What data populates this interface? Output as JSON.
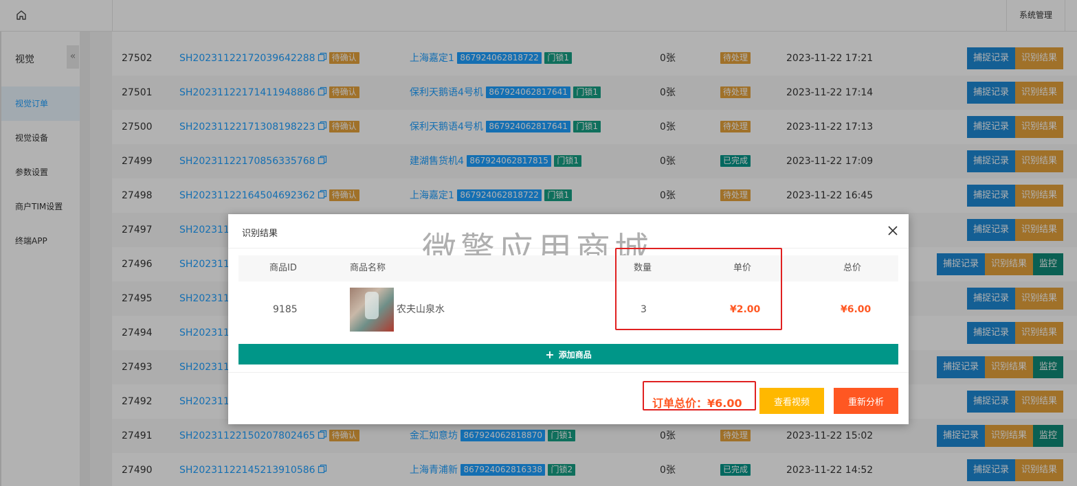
{
  "topbar": {
    "system_menu": "系统管理"
  },
  "sidebar": {
    "title": "视觉",
    "collapse_symbol": "«",
    "items": [
      "视觉订单",
      "视觉设备",
      "参数设置",
      "商户TIM设置",
      "终端APP"
    ]
  },
  "table": {
    "rows": [
      {
        "id": "27502",
        "sn": "SH20231122172039642288",
        "confirm": "待确认",
        "store": "上海嘉定1",
        "device": "867924062818722",
        "lock": "门锁1",
        "qty": "0张",
        "status": "待处理",
        "time": "2023-11-22 17:21"
      },
      {
        "id": "27501",
        "sn": "SH20231122171411948886",
        "confirm": "待确认",
        "store": "保利天鹅语4号机",
        "device": "867924062817641",
        "lock": "门锁1",
        "qty": "0张",
        "status": "待处理",
        "time": "2023-11-22 17:14"
      },
      {
        "id": "27500",
        "sn": "SH20231122171308198223",
        "confirm": "待确认",
        "store": "保利天鹅语4号机",
        "device": "867924062817641",
        "lock": "门锁1",
        "qty": "0张",
        "status": "待处理",
        "time": "2023-11-22 17:13"
      },
      {
        "id": "27499",
        "sn": "SH20231122170856335768",
        "confirm": "",
        "store": "建湖售货机4",
        "device": "867924062817815",
        "lock": "门锁1",
        "qty": "0张",
        "status": "已完成",
        "time": "2023-11-22 17:09"
      },
      {
        "id": "27498",
        "sn": "SH20231122164504692362",
        "confirm": "待确认",
        "store": "上海嘉定1",
        "device": "867924062818722",
        "lock": "门锁1",
        "qty": "0张",
        "status": "待处理",
        "time": "2023-11-22 16:45"
      },
      {
        "id": "27497",
        "sn": "SH2023112"
      },
      {
        "id": "27496",
        "sn": "SH2023112"
      },
      {
        "id": "27495",
        "sn": "SH2023112"
      },
      {
        "id": "27494",
        "sn": "SH2023112"
      },
      {
        "id": "27493",
        "sn": "SH2023112"
      },
      {
        "id": "27492",
        "sn": "SH2023112"
      },
      {
        "id": "27491",
        "sn": "SH20231122150207802465",
        "confirm": "待确认",
        "store": "金汇如意坊",
        "device": "867924062818870",
        "lock": "门锁1",
        "qty": "0张",
        "status": "待处理",
        "time": "2023-11-22 15:02"
      },
      {
        "id": "27490",
        "sn": "SH20231122145213910586",
        "confirm": "",
        "store": "上海青浦新",
        "device": "867924062816338",
        "lock": "门锁2",
        "qty": "0张",
        "status": "已完成",
        "time": "2023-11-22 14:52"
      }
    ],
    "actions": {
      "capture": "捕捉记录",
      "result": "识别结果",
      "monitor": "监控"
    }
  },
  "modal": {
    "title": "识别结果",
    "watermark": "微擎应用商城",
    "headers": {
      "id": "商品ID",
      "name": "商品名称",
      "qty": "数量",
      "unit_price": "单价",
      "total": "总价"
    },
    "item": {
      "id": "9185",
      "name": "农夫山泉水",
      "qty": "3",
      "unit_price": "¥2.00",
      "total": "¥6.00"
    },
    "add_button": "添加商品",
    "order_total": "订单总价：¥6.00",
    "view_video": "查看视频",
    "reanalyze": "重新分析"
  },
  "colors": {
    "primary": "#1e9fff",
    "teal": "#009688",
    "orange": "#ff5722",
    "yellow": "#ffb800",
    "highlight": "#e02020"
  }
}
